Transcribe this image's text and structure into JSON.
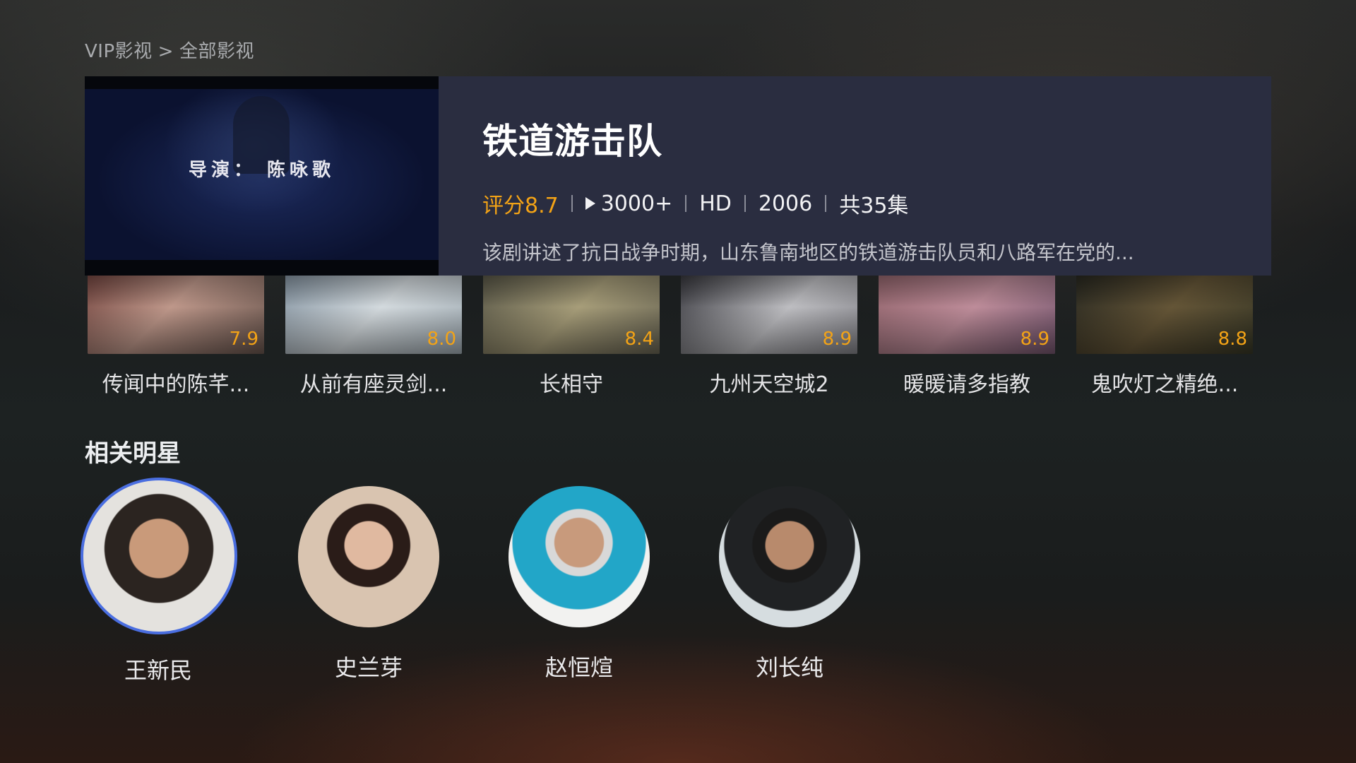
{
  "breadcrumb": {
    "root": "VIP影视",
    "separator": ">",
    "current": "全部影视"
  },
  "featured": {
    "thumbnail_caption": "导演： 陈咏歌",
    "title": "铁道游击队",
    "rating": "评分8.7",
    "plays": "3000+",
    "quality": "HD",
    "year": "2006",
    "episodes": "共35集",
    "description": "该剧讲述了抗日战争时期，山东鲁南地区的铁道游击队员和八路军在党的..."
  },
  "movies": [
    {
      "title": "传闻中的陈芊...",
      "score": "7.9"
    },
    {
      "title": "从前有座灵剑...",
      "score": "8.0"
    },
    {
      "title": "长相守",
      "score": "8.4"
    },
    {
      "title": "九州天空城2",
      "score": "8.9"
    },
    {
      "title": "暖暖请多指教",
      "score": "8.9"
    },
    {
      "title": "鬼吹灯之精绝...",
      "score": "8.8"
    }
  ],
  "stars_section": {
    "title": "相关明星",
    "stars": [
      {
        "name": "王新民",
        "focused": true
      },
      {
        "name": "史兰芽",
        "focused": false
      },
      {
        "name": "赵恒煊",
        "focused": false
      },
      {
        "name": "刘长纯",
        "focused": false
      }
    ]
  },
  "colors": {
    "accent_rating": "#f3a316",
    "focus_ring": "#4a6ee0",
    "card_bg": "#2a2d40"
  },
  "icons": {
    "play": "play-icon"
  }
}
